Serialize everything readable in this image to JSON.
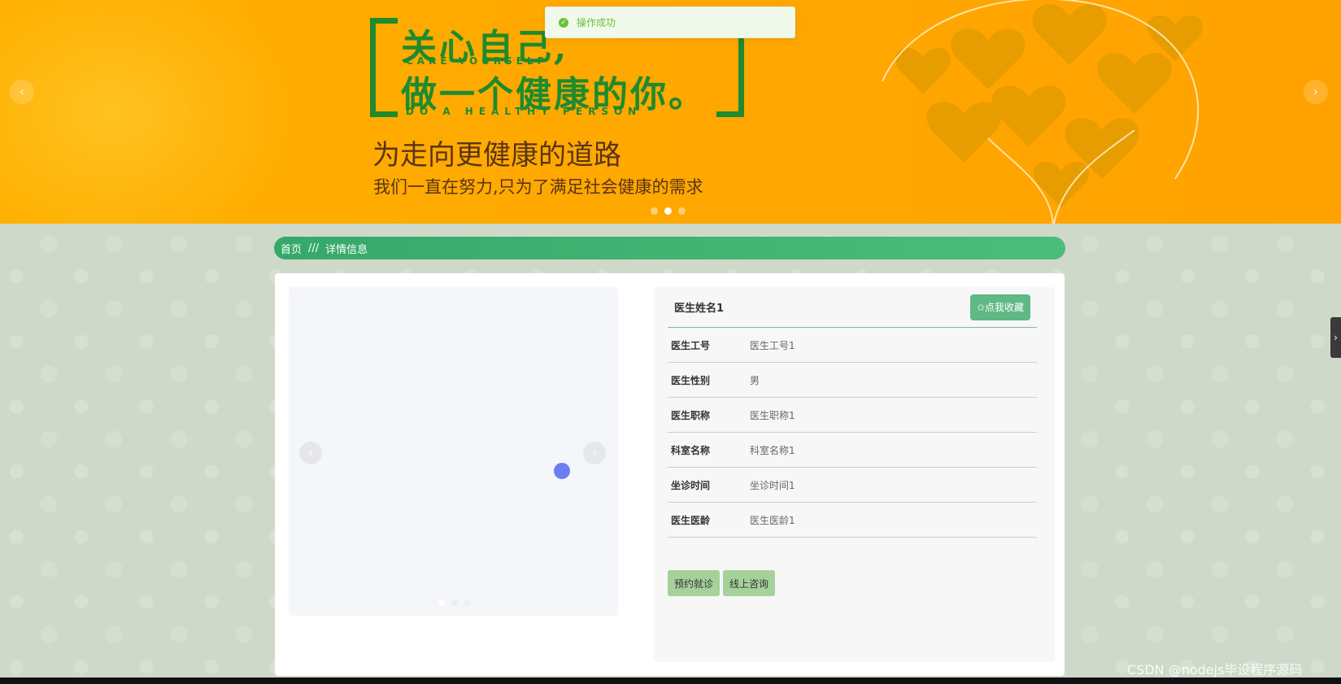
{
  "toast": {
    "message": "操作成功"
  },
  "banner": {
    "headline_line1": "关心自己,",
    "headline_en1": "CARE YOURSELF",
    "headline_line2": "做一个健康的你。",
    "headline_en2": "DO A HEALTHY PERSON",
    "subtitle1": "为走向更健康的道路",
    "subtitle2": "我们一直在努力,只为了满足社会健康的需求",
    "prev_icon": "‹",
    "next_icon": "›",
    "slide_count": 3,
    "active_slide": 2
  },
  "breadcrumb": {
    "home": "首页",
    "separator": "///",
    "current": "详情信息"
  },
  "detail": {
    "name": "医生姓名1",
    "favorite_label": "✩点我收藏",
    "rows": [
      {
        "label": "医生工号",
        "value": "医生工号1"
      },
      {
        "label": "医生性别",
        "value": "男"
      },
      {
        "label": "医生职称",
        "value": "医生职称1"
      },
      {
        "label": "科室名称",
        "value": "科室名称1"
      },
      {
        "label": "坐诊时间",
        "value": "坐诊时间1"
      },
      {
        "label": "医生医龄",
        "value": "医生医龄1"
      }
    ],
    "actions": [
      "预约就诊",
      "线上咨询"
    ]
  },
  "gallery": {
    "prev_icon": "‹",
    "next_icon": "›",
    "slide_count": 3,
    "active_slide": 1
  },
  "side_tab_icon": "›",
  "watermark": "CSDN @nodejs毕设程序源码",
  "colors": {
    "banner": "#ffa800",
    "brand_green": "#1f8a2e",
    "breadcrumb_green": "#36a86a",
    "button_green": "#5fb985",
    "action_green": "#a5d19a",
    "success": "#67c23a"
  }
}
